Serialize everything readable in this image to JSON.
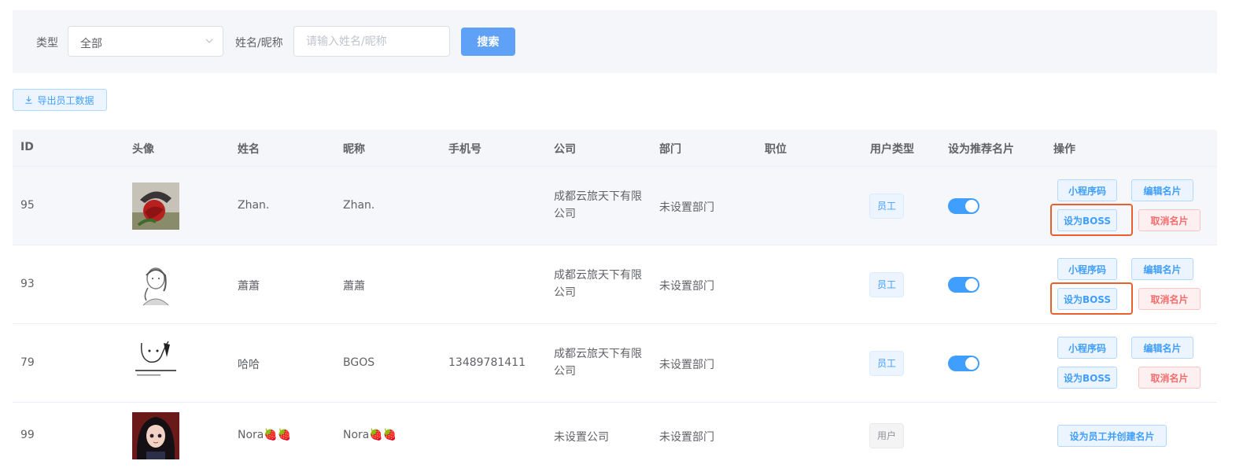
{
  "filters": {
    "type_label": "类型",
    "type_value": "全部",
    "name_label": "姓名/昵称",
    "name_placeholder": "请输入姓名/昵称",
    "search_button": "搜索"
  },
  "toolbar": {
    "export_button": "导出员工数据"
  },
  "table": {
    "columns": [
      "ID",
      "头像",
      "姓名",
      "昵称",
      "手机号",
      "公司",
      "部门",
      "职位",
      "用户类型",
      "设为推荐名片",
      "操作"
    ],
    "rows": [
      {
        "id": "95",
        "avatar": "rose-avatar",
        "name": "Zhan.",
        "nickname": "Zhan.",
        "phone": "",
        "company": "成都云旅天下有限公司",
        "department": "未设置部门",
        "position": "",
        "user_type": "员工",
        "recommended": true
      },
      {
        "id": "93",
        "avatar": "sketch-girl-avatar",
        "name": "蕭蕭",
        "nickname": "蕭蕭",
        "phone": "",
        "company": "成都云旅天下有限公司",
        "department": "未设置部门",
        "position": "",
        "user_type": "员工",
        "recommended": true
      },
      {
        "id": "79",
        "avatar": "meme-avatar",
        "name": "哈哈",
        "nickname": "BGOS",
        "phone": "13489781411",
        "company": "成都云旅天下有限公司",
        "department": "未设置部门",
        "position": "",
        "user_type": "员工",
        "recommended": true
      },
      {
        "id": "99",
        "avatar": "anime-girl-avatar",
        "name": "Nora🍓🍓",
        "nickname": "Nora🍓🍓",
        "phone": "",
        "company": "未设置公司",
        "department": "未设置部门",
        "position": "",
        "user_type": "用户",
        "recommended": null
      }
    ],
    "actions": {
      "miniprogram_code": "小程序码",
      "edit_card": "编辑名片",
      "set_boss": "设为BOSS",
      "cancel_card": "取消名片",
      "set_employee_create_card": "设为员工并创建名片"
    }
  },
  "colors": {
    "primary": "#409eff",
    "search_button": "#5ea1f7",
    "danger": "#f56c6c",
    "highlight": "#e8602c",
    "header_bg": "#f4f6f9"
  }
}
